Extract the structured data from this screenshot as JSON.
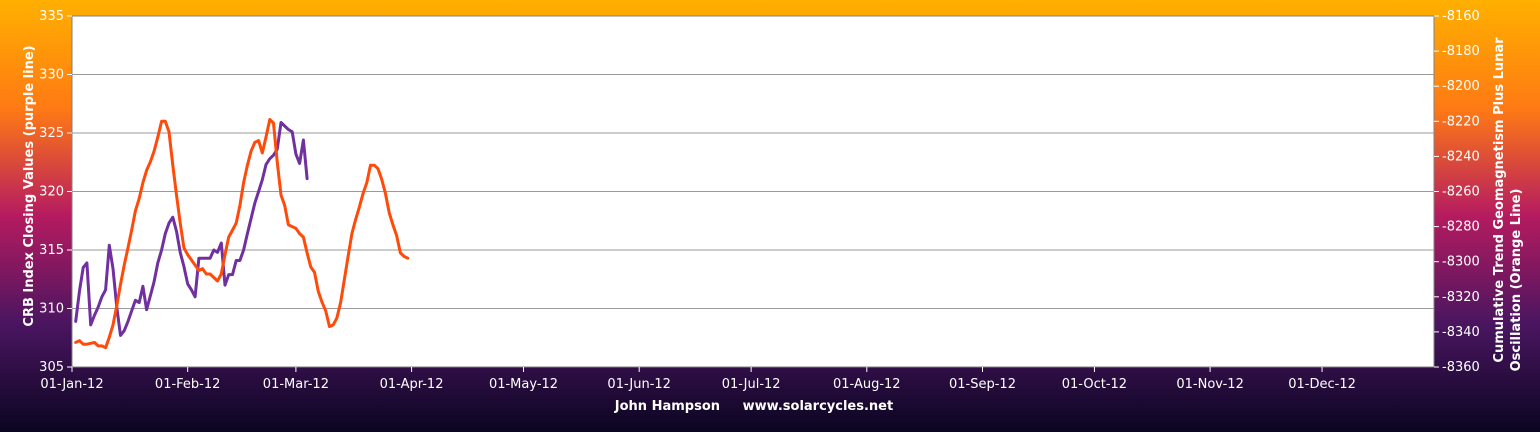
{
  "chart_data": {
    "type": "line",
    "background_gradient": [
      "#ffb000",
      "#ff7a14",
      "#b51b60",
      "#4a1560",
      "#0a0520"
    ],
    "plot_background": "#ffffff",
    "grid_color": "#9a9a9a",
    "left_axis": {
      "label": "CRB Index Closing Values (purple line)",
      "range": [
        305,
        335
      ],
      "ticks": [
        "305",
        "310",
        "315",
        "320",
        "325",
        "330",
        "335"
      ]
    },
    "right_axis": {
      "label_lines": [
        "Cumulative Trend Geomagnetism Plus Lunar",
        "Oscillation (Orange Line)"
      ],
      "range": [
        -8360,
        -8160
      ],
      "ticks": [
        "-8360",
        "-8340",
        "-8320",
        "-8300",
        "-8280",
        "-8260",
        "-8240",
        "-8220",
        "-8200",
        "-8180",
        "-8160"
      ]
    },
    "x_axis": {
      "range": [
        "2012-01-01",
        "2012-12-31"
      ],
      "tick_labels": [
        "01-Jan-12",
        "01-Feb-12",
        "01-Mar-12",
        "01-Apr-12",
        "01-May-12",
        "01-Jun-12",
        "01-Jul-12",
        "01-Aug-12",
        "01-Sep-12",
        "01-Oct-12",
        "01-Nov-12",
        "01-Dec-12"
      ],
      "tick_dates": [
        "2012-01-01",
        "2012-02-01",
        "2012-03-01",
        "2012-04-01",
        "2012-05-01",
        "2012-06-01",
        "2012-07-01",
        "2012-08-01",
        "2012-09-01",
        "2012-10-01",
        "2012-11-01",
        "2012-12-01"
      ]
    },
    "credit": "John Hampson     www.solarcycles.net",
    "series": [
      {
        "axis": "left",
        "color": "#7030a0",
        "points": [
          [
            "2012-01-02",
            308.9
          ],
          [
            "2012-01-03",
            311.5
          ],
          [
            "2012-01-04",
            313.5
          ],
          [
            "2012-01-05",
            313.9
          ],
          [
            "2012-01-06",
            308.6
          ],
          [
            "2012-01-07",
            309.4
          ],
          [
            "2012-01-08",
            310.1
          ],
          [
            "2012-01-09",
            311.0
          ],
          [
            "2012-01-10",
            311.6
          ],
          [
            "2012-01-11",
            315.4
          ],
          [
            "2012-01-12",
            313.4
          ],
          [
            "2012-01-13",
            310.1
          ],
          [
            "2012-01-14",
            307.7
          ],
          [
            "2012-01-15",
            308.1
          ],
          [
            "2012-01-16",
            308.9
          ],
          [
            "2012-01-17",
            309.8
          ],
          [
            "2012-01-18",
            310.7
          ],
          [
            "2012-01-19",
            310.5
          ],
          [
            "2012-01-20",
            311.9
          ],
          [
            "2012-01-21",
            309.9
          ],
          [
            "2012-01-22",
            311.1
          ],
          [
            "2012-01-23",
            312.3
          ],
          [
            "2012-01-24",
            313.9
          ],
          [
            "2012-01-25",
            315.0
          ],
          [
            "2012-01-26",
            316.4
          ],
          [
            "2012-01-27",
            317.3
          ],
          [
            "2012-01-28",
            317.8
          ],
          [
            "2012-01-29",
            316.6
          ],
          [
            "2012-01-30",
            314.8
          ],
          [
            "2012-01-31",
            313.6
          ],
          [
            "2012-02-01",
            312.1
          ],
          [
            "2012-02-02",
            311.6
          ],
          [
            "2012-02-03",
            311.0
          ],
          [
            "2012-02-04",
            314.3
          ],
          [
            "2012-02-05",
            314.3
          ],
          [
            "2012-02-06",
            314.3
          ],
          [
            "2012-02-07",
            314.3
          ],
          [
            "2012-02-08",
            315.0
          ],
          [
            "2012-02-09",
            314.8
          ],
          [
            "2012-02-10",
            315.6
          ],
          [
            "2012-02-11",
            312.0
          ],
          [
            "2012-02-12",
            312.9
          ],
          [
            "2012-02-13",
            312.9
          ],
          [
            "2012-02-14",
            314.1
          ],
          [
            "2012-02-15",
            314.1
          ],
          [
            "2012-02-16",
            315.0
          ],
          [
            "2012-02-17",
            316.4
          ],
          [
            "2012-02-18",
            317.7
          ],
          [
            "2012-02-19",
            319.0
          ],
          [
            "2012-02-20",
            320.0
          ],
          [
            "2012-02-21",
            321.0
          ],
          [
            "2012-02-22",
            322.3
          ],
          [
            "2012-02-23",
            322.8
          ],
          [
            "2012-02-24",
            323.1
          ],
          [
            "2012-02-25",
            323.6
          ],
          [
            "2012-02-26",
            325.9
          ],
          [
            "2012-02-27",
            325.6
          ],
          [
            "2012-02-28",
            325.3
          ],
          [
            "2012-02-29",
            325.1
          ],
          [
            "2012-03-01",
            323.2
          ],
          [
            "2012-03-02",
            322.4
          ],
          [
            "2012-03-03",
            324.4
          ],
          [
            "2012-03-04",
            321.1
          ]
        ]
      },
      {
        "axis": "right",
        "color": "#ff4a0a",
        "points": [
          [
            "2012-01-02",
            -8346
          ],
          [
            "2012-01-03",
            -8345
          ],
          [
            "2012-01-04",
            -8347
          ],
          [
            "2012-01-05",
            -8347
          ],
          [
            "2012-01-07",
            -8346
          ],
          [
            "2012-01-08",
            -8348
          ],
          [
            "2012-01-09",
            -8348
          ],
          [
            "2012-01-10",
            -8349
          ],
          [
            "2012-01-11",
            -8343
          ],
          [
            "2012-01-12",
            -8336
          ],
          [
            "2012-01-13",
            -8325
          ],
          [
            "2012-01-14",
            -8313
          ],
          [
            "2012-01-15",
            -8302
          ],
          [
            "2012-01-16",
            -8292
          ],
          [
            "2012-01-17",
            -8282
          ],
          [
            "2012-01-18",
            -8271
          ],
          [
            "2012-01-19",
            -8264
          ],
          [
            "2012-01-20",
            -8255
          ],
          [
            "2012-01-21",
            -8248
          ],
          [
            "2012-01-22",
            -8243
          ],
          [
            "2012-01-23",
            -8237
          ],
          [
            "2012-01-24",
            -8229
          ],
          [
            "2012-01-25",
            -8220
          ],
          [
            "2012-01-26",
            -8220
          ],
          [
            "2012-01-27",
            -8226
          ],
          [
            "2012-01-28",
            -8245
          ],
          [
            "2012-01-29",
            -8262
          ],
          [
            "2012-01-30",
            -8278
          ],
          [
            "2012-01-31",
            -8292
          ],
          [
            "2012-02-01",
            -8296
          ],
          [
            "2012-02-02",
            -8299
          ],
          [
            "2012-02-03",
            -8302
          ],
          [
            "2012-02-04",
            -8305
          ],
          [
            "2012-02-05",
            -8304
          ],
          [
            "2012-02-06",
            -8307
          ],
          [
            "2012-02-07",
            -8307
          ],
          [
            "2012-02-08",
            -8309
          ],
          [
            "2012-02-09",
            -8311
          ],
          [
            "2012-02-10",
            -8307
          ],
          [
            "2012-02-11",
            -8296
          ],
          [
            "2012-02-12",
            -8286
          ],
          [
            "2012-02-13",
            -8282
          ],
          [
            "2012-02-14",
            -8278
          ],
          [
            "2012-02-15",
            -8268
          ],
          [
            "2012-02-16",
            -8255
          ],
          [
            "2012-02-17",
            -8245
          ],
          [
            "2012-02-18",
            -8237
          ],
          [
            "2012-02-19",
            -8232
          ],
          [
            "2012-02-20",
            -8231
          ],
          [
            "2012-02-21",
            -8238
          ],
          [
            "2012-02-22",
            -8229
          ],
          [
            "2012-02-23",
            -8219
          ],
          [
            "2012-02-24",
            -8221
          ],
          [
            "2012-02-25",
            -8243
          ],
          [
            "2012-02-26",
            -8262
          ],
          [
            "2012-02-27",
            -8268
          ],
          [
            "2012-02-28",
            -8279
          ],
          [
            "2012-03-01",
            -8281
          ],
          [
            "2012-03-02",
            -8284
          ],
          [
            "2012-03-03",
            -8286
          ],
          [
            "2012-03-04",
            -8295
          ],
          [
            "2012-03-05",
            -8303
          ],
          [
            "2012-03-06",
            -8306
          ],
          [
            "2012-03-07",
            -8317
          ],
          [
            "2012-03-08",
            -8323
          ],
          [
            "2012-03-09",
            -8328
          ],
          [
            "2012-03-10",
            -8337
          ],
          [
            "2012-03-11",
            -8336
          ],
          [
            "2012-03-12",
            -8332
          ],
          [
            "2012-03-13",
            -8323
          ],
          [
            "2012-03-14",
            -8310
          ],
          [
            "2012-03-15",
            -8297
          ],
          [
            "2012-03-16",
            -8284
          ],
          [
            "2012-03-17",
            -8276
          ],
          [
            "2012-03-18",
            -8269
          ],
          [
            "2012-03-19",
            -8261
          ],
          [
            "2012-03-20",
            -8255
          ],
          [
            "2012-03-21",
            -8245
          ],
          [
            "2012-03-22",
            -8245
          ],
          [
            "2012-03-23",
            -8247
          ],
          [
            "2012-03-24",
            -8253
          ],
          [
            "2012-03-25",
            -8261
          ],
          [
            "2012-03-26",
            -8272
          ],
          [
            "2012-03-27",
            -8279
          ],
          [
            "2012-03-28",
            -8285
          ],
          [
            "2012-03-29",
            -8295
          ],
          [
            "2012-03-30",
            -8297
          ],
          [
            "2012-03-31",
            -8298
          ]
        ]
      }
    ]
  }
}
